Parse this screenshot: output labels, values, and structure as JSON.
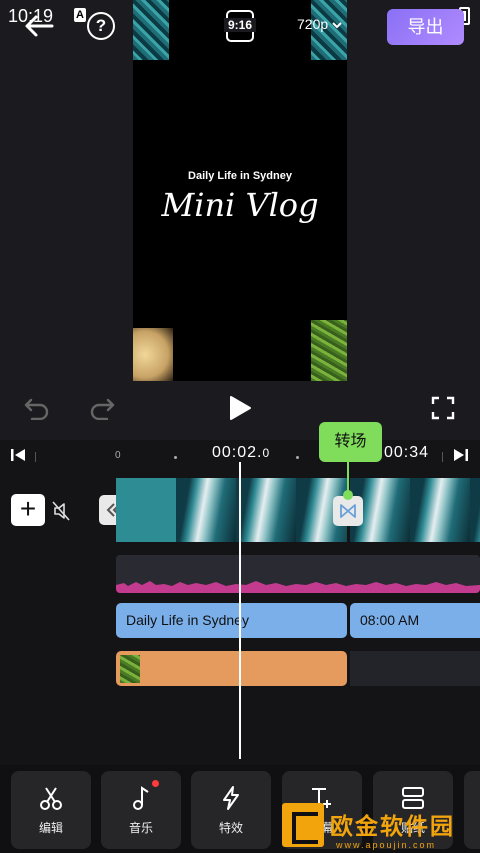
{
  "status_bar": {
    "time": "10:19",
    "badge": "A"
  },
  "header": {
    "ratio": "9:16",
    "resolution": "720p",
    "export_label": "导出"
  },
  "preview": {
    "subtitle": "Daily Life in Sydney",
    "title": "Mini Vlog"
  },
  "timeline": {
    "current_time_main": "00:02.",
    "current_time_frac": "0",
    "total_time": "00:34",
    "tick_zero": "0"
  },
  "tooltip": {
    "label": "转场"
  },
  "tracks": {
    "text_1": "Daily Life in Sydney",
    "text_2": "08:00 AM"
  },
  "toolbar": {
    "items": [
      {
        "label": "编辑"
      },
      {
        "label": "音乐"
      },
      {
        "label": "特效"
      },
      {
        "label": "字幕"
      },
      {
        "label": "贴纸"
      }
    ]
  },
  "watermark": {
    "name": "欧金软件园",
    "url": "www.apoujin.com"
  },
  "colors": {
    "accent": "#8a70f5",
    "transition": "#7fdd5b",
    "text_track": "#7aafea",
    "sticker_track": "#e59a5e"
  }
}
